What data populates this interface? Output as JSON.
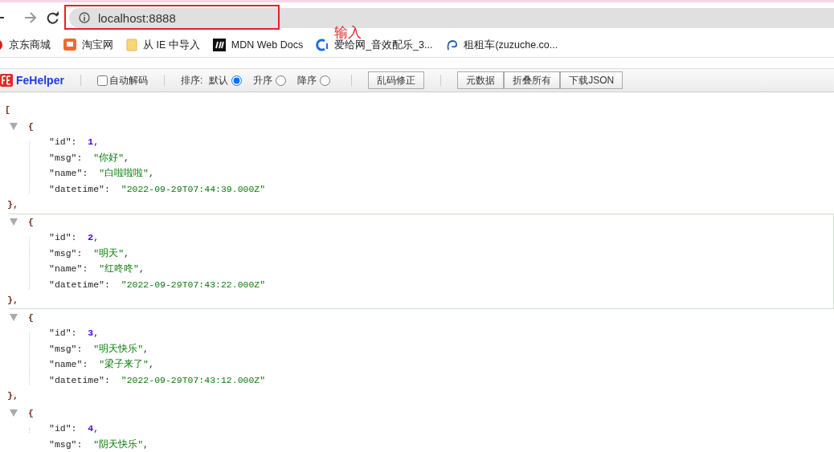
{
  "browser": {
    "url": "localhost:8888",
    "annotation": "输入"
  },
  "bookmarks": [
    {
      "label": "京东商城"
    },
    {
      "label": "淘宝网"
    },
    {
      "label": "从 IE 中导入"
    },
    {
      "label": "MDN Web Docs"
    },
    {
      "label": "爱给网_音效配乐_3..."
    },
    {
      "label": "租租车(zuzuche.co..."
    }
  ],
  "toolbar": {
    "brand": "FeHelper",
    "auto_decode": {
      "label": "自动解码",
      "checked": false
    },
    "sort_label": "排序:",
    "sort_options": [
      {
        "label": "默认",
        "selected": true
      },
      {
        "label": "升序",
        "selected": false
      },
      {
        "label": "降序",
        "selected": false
      }
    ],
    "fix_button": "乱码修正",
    "buttons": [
      "元数据",
      "折叠所有",
      "下载JSON"
    ]
  },
  "json": {
    "open": "[",
    "objects": [
      {
        "open": "{",
        "close": "},",
        "selected": false,
        "expanded": true,
        "fields": [
          {
            "key": "\"id\":",
            "value": "1",
            "kind": "number",
            "comma": ","
          },
          {
            "key": "\"msg\":",
            "value": "\"你好\"",
            "kind": "string",
            "comma": ","
          },
          {
            "key": "\"name\":",
            "value": "\"白啦啦啦\"",
            "kind": "string",
            "comma": ","
          },
          {
            "key": "\"datetime\":",
            "value": "\"2022-09-29T07:44:39.000Z\"",
            "kind": "string"
          }
        ]
      },
      {
        "open": "{",
        "close": "},",
        "selected": true,
        "expanded": true,
        "fields": [
          {
            "key": "\"id\":",
            "value": "2",
            "kind": "number",
            "comma": ","
          },
          {
            "key": "\"msg\":",
            "value": "\"明天\"",
            "kind": "string",
            "comma": ","
          },
          {
            "key": "\"name\":",
            "value": "\"红咚咚\"",
            "kind": "string",
            "comma": ","
          },
          {
            "key": "\"datetime\":",
            "value": "\"2022-09-29T07:43:22.000Z\"",
            "kind": "string"
          }
        ]
      },
      {
        "open": "{",
        "close": "},",
        "selected": false,
        "expanded": true,
        "fields": [
          {
            "key": "\"id\":",
            "value": "3",
            "kind": "number",
            "comma": ","
          },
          {
            "key": "\"msg\":",
            "value": "\"明天快乐\"",
            "kind": "string",
            "comma": ","
          },
          {
            "key": "\"name\":",
            "value": "\"梁子来了\"",
            "kind": "string",
            "comma": ","
          },
          {
            "key": "\"datetime\":",
            "value": "\"2022-09-29T07:43:12.000Z\"",
            "kind": "string"
          }
        ]
      },
      {
        "open": "{",
        "selected": false,
        "expanded": true,
        "fields": [
          {
            "key": "\"id\":",
            "value": "4",
            "kind": "number",
            "comma": ","
          },
          {
            "key": "\"msg\":",
            "value": "\"阴天快乐\"",
            "kind": "string",
            "comma": ","
          }
        ]
      }
    ]
  }
}
